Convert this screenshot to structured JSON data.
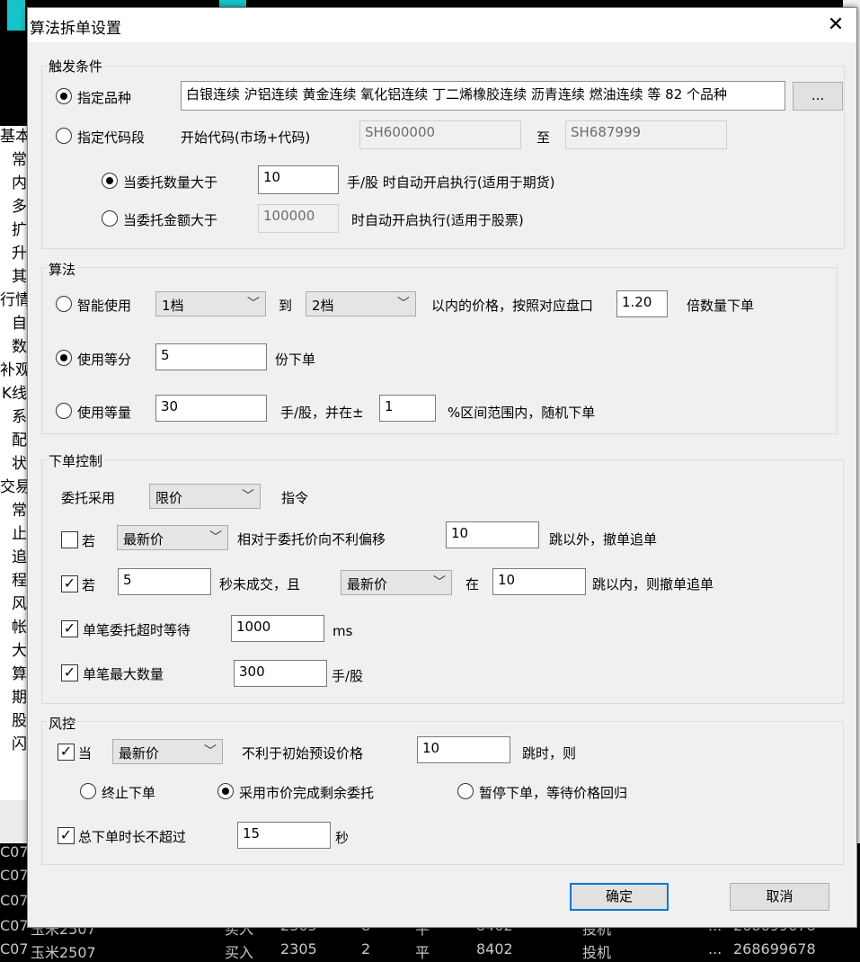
{
  "background": {
    "left_items": [
      "基本",
      "常",
      "内",
      "多",
      "扩",
      "升",
      "其",
      "行情",
      "自",
      "数",
      "补观",
      "K线",
      "系",
      "配",
      "状",
      "交易",
      "常",
      "止",
      "追",
      "程",
      "风",
      "帐",
      "大",
      "算",
      "期",
      "股",
      "闪"
    ],
    "rows": [
      {
        "code": "C07",
        "name": "",
        "side": "",
        "price": "",
        "qty": "",
        "open": "",
        "last": "",
        "type": "",
        "dots": "",
        "id": ""
      },
      {
        "code": "C07",
        "name": "",
        "side": "",
        "price": "",
        "qty": "",
        "open": "",
        "last": "",
        "type": "",
        "dots": "",
        "id": ""
      },
      {
        "code": "C07",
        "name": "",
        "side": "",
        "price": "",
        "qty": "",
        "open": "",
        "last": "",
        "type": "",
        "dots": "",
        "id": ""
      },
      {
        "code": "C07",
        "name": "玉米2507",
        "side": "买入",
        "price": "2305",
        "qty": "8",
        "open": "平",
        "last": "8402",
        "type": "投机",
        "dots": "...",
        "id": "268699678"
      },
      {
        "code": "C07",
        "name": "玉米2507",
        "side": "买入",
        "price": "2305",
        "qty": "2",
        "open": "平",
        "last": "8402",
        "type": "投机",
        "dots": "...",
        "id": "268699678"
      }
    ]
  },
  "dialog": {
    "title": "算法拆单设置",
    "close_glyph": "✕",
    "trigger": {
      "group_label": "触发条件",
      "specify_variety_label": "指定品种",
      "variety_list": "白银连续 沪铝连续 黄金连续 氧化铝连续 丁二烯橡胶连续 沥青连续 燃油连续 等 82 个品种",
      "browse_label": "...",
      "specify_code_range_label": "指定代码段",
      "start_code_label": "开始代码(市场+代码)",
      "start_code": "SH600000",
      "to_label": "至",
      "end_code": "SH687999",
      "qty_condition_label": "当委托数量大于",
      "qty_value": "10",
      "qty_suffix": "手/股 时自动开启执行(适用于期货)",
      "amount_condition_label": "当委托金额大于",
      "amount_value": "100000",
      "amount_suffix": "时自动开启执行(适用于股票)"
    },
    "algo": {
      "group_label": "算法",
      "smart_label": "智能使用",
      "from_level": "1档",
      "to_label": "到",
      "to_level": "2档",
      "price_text": "以内的价格，按照对应盘口",
      "multiplier": "1.20",
      "multiplier_suffix": "倍数量下单",
      "equal_parts_label": "使用等分",
      "parts_value": "5",
      "parts_suffix": "份下单",
      "equal_qty_label": "使用等量",
      "qty_value": "30",
      "qty_mid": "手/股，并在±",
      "range_value": "1",
      "range_suffix": "%区间范围内，随机下单"
    },
    "order": {
      "group_label": "下单控制",
      "use_label": "委托采用",
      "use_value": "限价",
      "use_suffix": "指令",
      "if1_label": "若",
      "if1_price": "最新价",
      "if1_text": "相对于委托价向不利偏移",
      "if1_ticks": "10",
      "if1_suffix": "跳以外，撤单追单",
      "if2_label": "若",
      "if2_seconds": "5",
      "if2_text": "秒未成交，且",
      "if2_price": "最新价",
      "if2_in": "在",
      "if2_ticks": "10",
      "if2_suffix": "跳以内，则撤单追单",
      "timeout_label": "单笔委托超时等待",
      "timeout_value": "1000",
      "timeout_unit": "ms",
      "maxqty_label": "单笔最大数量",
      "maxqty_value": "300",
      "maxqty_unit": "手/股"
    },
    "risk": {
      "group_label": "风控",
      "when_label": "当",
      "when_price": "最新价",
      "when_text": "不利于初始预设价格",
      "when_ticks": "10",
      "when_suffix": "跳时，则",
      "opt_stop": "终止下单",
      "opt_market": "采用市价完成剩余委托",
      "opt_pause": "暂停下单，等待价格回归",
      "total_label": "总下单时长不超过",
      "total_value": "15",
      "total_unit": "秒"
    },
    "ok_label": "确定",
    "cancel_label": "取消",
    "dropdown_glyph": "﹀",
    "check_glyph": "✓"
  }
}
